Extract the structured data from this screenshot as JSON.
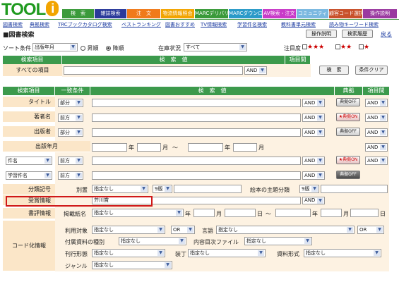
{
  "logo": {
    "text": "TOOL",
    "i_letter": "i"
  },
  "tabs": [
    {
      "label": "検　索",
      "color": "#3a9a3a"
    },
    {
      "label": "雑誌検索",
      "color": "#2a3a9a"
    },
    {
      "label": "注　文",
      "color": "#f07a1a"
    },
    {
      "label": "物流情報照会",
      "color": "#f2a400"
    },
    {
      "label": "MARCデリバリ",
      "color": "#3a9a3a"
    },
    {
      "label": "MARCダウンロード",
      "color": "#2a9ac8"
    },
    {
      "label": "AV検索・注文",
      "color": "#c83ac8"
    },
    {
      "label": "コミュニティ",
      "color": "#7ab8e0"
    },
    {
      "label": "顧客コード選択",
      "color": "#c8502a"
    },
    {
      "label": "操作説明",
      "color": "#9a3aa0"
    }
  ],
  "nav_links": [
    "図書検索",
    "典拠検索",
    "TRCブックカタログ検索",
    "ベストランキング",
    "図書おすすめ",
    "TV情報検索",
    "学習件名検索",
    "教科書単元検索",
    "読み物キーワード検索"
  ],
  "page_title": "■図書検索",
  "header_buttons": {
    "manual": "操作説明",
    "history": "検索履歴",
    "back": "戻る"
  },
  "sort": {
    "label": "ソート条件",
    "field": "出版年月",
    "asc": "昇順",
    "desc": "降順",
    "stock_label": "在庫状況",
    "stock_value": "すべて",
    "attention_label": "注目度",
    "stars3": "★★★",
    "stars2": "★★",
    "stars1": "★"
  },
  "all_items": {
    "col_item": "検索項目",
    "col_value": "検　索　値",
    "col_between": "項目間",
    "label": "すべての項目",
    "op": "AND",
    "search_button": "検　索",
    "clear_button": "条件クリア"
  },
  "grid": {
    "col_item": "検索項目",
    "col_match": "一致条件",
    "col_value": "検　索　値",
    "col_authority": "典拠",
    "col_between": "項目間"
  },
  "rows": {
    "title": {
      "label": "タイトル",
      "match": "部分",
      "op": "AND",
      "auth": "典拠OFF",
      "between": "AND"
    },
    "author": {
      "label": "著者名",
      "match": "前方",
      "op": "AND",
      "auth": "★典拠ON",
      "between": "AND"
    },
    "publisher": {
      "label": "出版者",
      "match": "部分",
      "op": "AND",
      "auth": "典拠OFF",
      "between": "AND"
    },
    "pubdate": {
      "label": "出版年月",
      "year": "年",
      "month": "月",
      "tilde": "〜",
      "between": "AND"
    },
    "subject": {
      "label": "件名",
      "match": "前方",
      "op": "AND",
      "auth": "★典拠ON",
      "between": "AND"
    },
    "learning": {
      "label": "学習件名",
      "match": "前方",
      "op": "AND",
      "auth": "典拠OFF"
    }
  },
  "classification": {
    "label": "分類記号",
    "sub_label": "別置",
    "sub_value": "指定なし",
    "ndc": "9版",
    "picture_label": "絵本の主題分類",
    "picture_ndc": "9版"
  },
  "award": {
    "label": "受賞情報",
    "value": "芥川賞",
    "op": "AND"
  },
  "review": {
    "label": "書評情報",
    "paper_label": "掲載紙名",
    "paper_value": "指定なし",
    "year": "年",
    "month": "月",
    "day": "日",
    "tilde": "〜"
  },
  "coded": {
    "label": "コード化情報",
    "target_label": "利用対象",
    "target_value": "指定なし",
    "or_value": "OR",
    "lang_label": "言語",
    "lang_value": "指定なし",
    "lang_or": "OR",
    "attach_label": "付属資料の種別",
    "attach_value": "指定なし",
    "toc_label": "内容目次ファイル",
    "toc_value": "指定なし",
    "form_label": "刊行形態",
    "form_value": "指定なし",
    "binding_label": "装丁",
    "binding_value": "指定なし",
    "material_label": "資料形式",
    "material_value": "指定なし",
    "genre_label": "ジャンル",
    "genre_value": "指定なし"
  }
}
